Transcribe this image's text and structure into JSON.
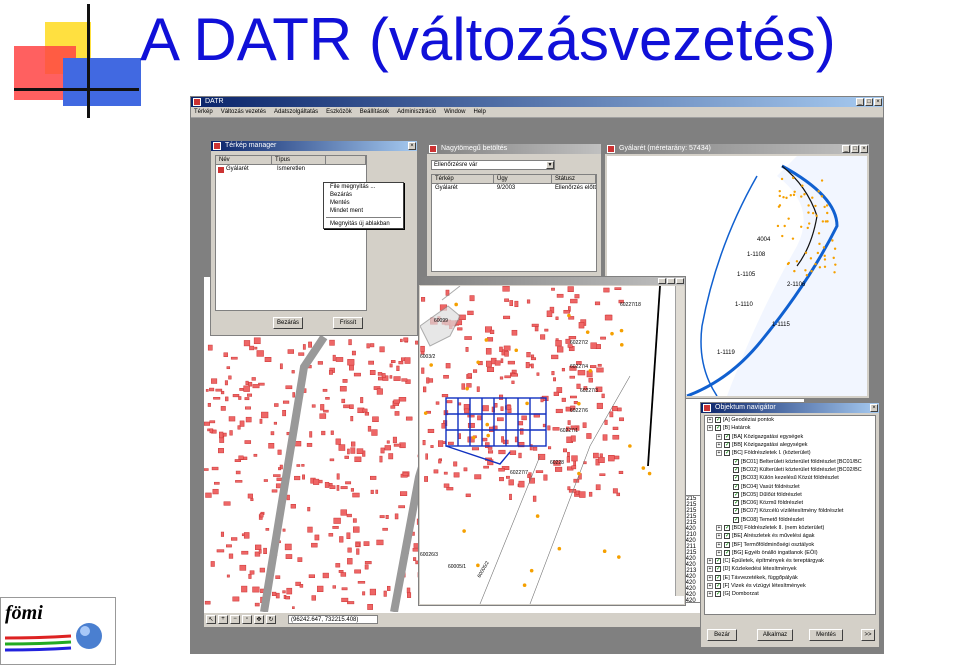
{
  "slide": {
    "title": "A DATR (változásvezetés)",
    "logo_text": "fömi"
  },
  "app": {
    "title": "DATR",
    "menu": [
      "Térkép",
      "Változás vezetés",
      "Adatszolgáltatás",
      "Eszközök",
      "Beállítások",
      "Adminisztráció",
      "Window",
      "Help"
    ],
    "status_coords": "(96242.647, 732215.408)"
  },
  "map_manager": {
    "title": "Térkép manager",
    "columns": [
      "Név",
      "Típus"
    ],
    "rows": [
      {
        "name": "Gyálarét",
        "type": "Ismeretlen"
      }
    ],
    "context_menu": [
      "File megnyitás ...",
      "Bezárás",
      "Mentés",
      "Mindet ment",
      "Megnyitás új ablakban"
    ],
    "close_label": "Bezárás",
    "refresh_label": "Frissít"
  },
  "bulk_load": {
    "title": "Nagytömegű betöltés",
    "filter": "Ellenőrzésre vár",
    "columns": [
      "Térkép",
      "Ügy",
      "Státusz"
    ],
    "rows": [
      {
        "map": "Gyálarét",
        "case": "9/2003",
        "status": "Ellenőrzés előtt"
      }
    ]
  },
  "gyalaret_window": {
    "title": "Gyálarét (méretarány: 57434)",
    "labels": [
      "1-1108",
      "1-1105",
      "1-1110",
      "1-1115",
      "1-1119",
      "4004",
      "2-1106"
    ]
  },
  "map_window": {
    "labels": [
      "60227/18",
      "60227/2",
      "60227/4",
      "60227/3",
      "60227/6",
      "60227/1",
      "60227/7",
      "60228",
      "60099",
      "6003/2",
      "60026/3",
      "60005/1",
      "60005/2"
    ]
  },
  "object_navigator": {
    "title": "Objektum navigátor",
    "items": [
      {
        "level": 0,
        "text": "[A] Geodéziai pontok"
      },
      {
        "level": 0,
        "text": "[B] Határok"
      },
      {
        "level": 1,
        "text": "[BA] Közigazgatási egységek"
      },
      {
        "level": 1,
        "text": "[BB] Közigazgatási alegységek"
      },
      {
        "level": 1,
        "text": "[BC] Földrészletek I. (közterület)"
      },
      {
        "level": 2,
        "text": "[BC01] Belterületi közterület földrészlet [BC01/BC"
      },
      {
        "level": 2,
        "text": "[BC02] Külterületi közterület földrészlet [BC02/BC"
      },
      {
        "level": 2,
        "text": "[BC03] Külön kezelésű Közút földrészlet"
      },
      {
        "level": 2,
        "text": "[BC04] Vasút földrészlet"
      },
      {
        "level": 2,
        "text": "[BC05] Dűlőút földrészlet"
      },
      {
        "level": 2,
        "text": "[BC06] Közmű földrészlet"
      },
      {
        "level": 2,
        "text": "[BC07] Közcélú vízilétesítmény földrészlet"
      },
      {
        "level": 2,
        "text": "[BC08] Temető földrészlet"
      },
      {
        "level": 1,
        "text": "[BD] Földrészletek II. (nem közterület)"
      },
      {
        "level": 1,
        "text": "[BE] Alrészletek és művelési ágak"
      },
      {
        "level": 1,
        "text": "[BF] Termőföldminőségi osztályok"
      },
      {
        "level": 1,
        "text": "[BG] Egyéb önálló ingatlanok (EÖI)"
      },
      {
        "level": 0,
        "text": "[C] Épületek, építmények és tereptárgyak"
      },
      {
        "level": 0,
        "text": "[D] Közlekedési létesítmények"
      },
      {
        "level": 0,
        "text": "[E] Távvezetékek, függőpályák"
      },
      {
        "level": 0,
        "text": "[F] Vizek és vízügyi létesítmények"
      },
      {
        "level": 0,
        "text": "[G] Domborzat"
      }
    ],
    "buttons": [
      "Bezár",
      "Alkalmaz",
      "Mentés",
      ">>"
    ]
  },
  "left_list": [
    "*K215",
    "*K215",
    "*K215",
    "*K215",
    "*K215",
    "*1420",
    "*K210",
    "*1420",
    "*K211",
    "*K215",
    "*1420",
    "*1420",
    "*K213",
    "*1420",
    "*1420",
    "*1420",
    "*1420",
    "*1420"
  ]
}
